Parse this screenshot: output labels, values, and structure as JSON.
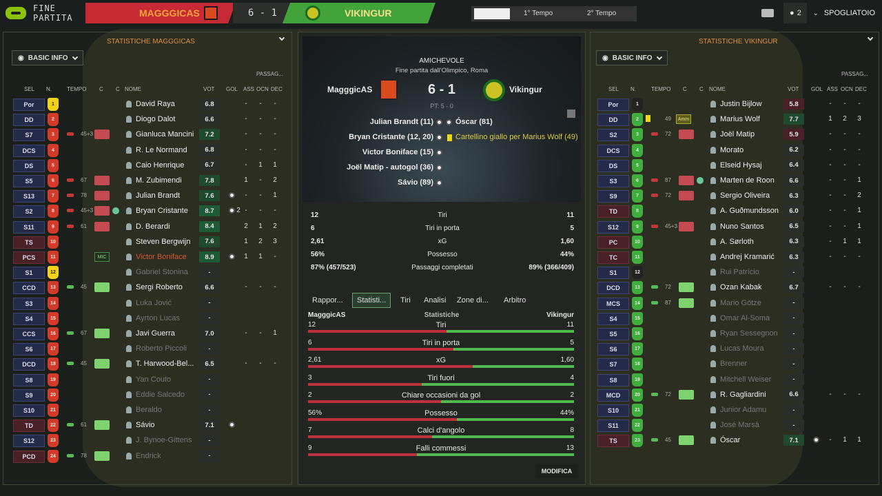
{
  "topbar": {
    "status": "FINE PARTITA",
    "home": "MAGGGICAS",
    "score": "6 - 1",
    "away": "VIKINGUR",
    "first_half": "1° Tempo",
    "second_half": "2° Tempo",
    "manager_count": "2",
    "spogliatoio": "SPOGLIATOIO"
  },
  "left": {
    "header": "STATISTICHE MAGGGICAS",
    "basic": "BASIC INFO",
    "cols": {
      "sel": "SEL",
      "n": "N.",
      "tempo": "TEMPO",
      "c1": "C",
      "c2": "C",
      "nome": "NOME",
      "vot": "VOT",
      "gol": "GOL",
      "ass": "ASS",
      "ocn": "OCN",
      "dec": "DEC",
      "passag": "PASSAG..."
    },
    "players": [
      {
        "sel": "Por",
        "num": "1",
        "name": "David Raya",
        "vot": "6.8",
        "ass": "-",
        "ocn": "-",
        "dec": "-",
        "gk": true,
        "active": true,
        "vc": "#2a2e2b"
      },
      {
        "sel": "DD",
        "num": "2",
        "name": "Diogo Dalot",
        "vot": "6.6",
        "ass": "-",
        "ocn": "-",
        "dec": "-",
        "active": true,
        "vc": "#2a2e2b"
      },
      {
        "sel": "S7",
        "num": "3",
        "name": "Gianluca Mancini",
        "vot": "7.2",
        "tem": "45+3",
        "ass": "-",
        "ocn": "-",
        "dec": "-",
        "sub": "out",
        "vc": "#1f4a2f"
      },
      {
        "sel": "DCS",
        "num": "4",
        "name": "R. Le Normand",
        "vot": "6.8",
        "ass": "-",
        "ocn": "-",
        "dec": "-",
        "active": true,
        "vc": "#2a2e2b"
      },
      {
        "sel": "DS",
        "num": "5",
        "name": "Caio Henrique",
        "vot": "6.7",
        "ass": "-",
        "ocn": "1",
        "dec": "1",
        "active": true,
        "vc": "#2a2e2b"
      },
      {
        "sel": "S5",
        "num": "6",
        "name": "M. Zubimendi",
        "vot": "7.8",
        "tem": "67",
        "ass": "1",
        "ocn": "-",
        "dec": "2",
        "sub": "out",
        "vc": "#1f4a2f"
      },
      {
        "sel": "S13",
        "num": "7",
        "name": "Julian Brandt",
        "vot": "7.6",
        "tem": "78",
        "ass": "-",
        "ocn": "-",
        "dec": "1",
        "sub": "out",
        "goal": true,
        "vc": "#1f4a2f"
      },
      {
        "sel": "S2",
        "num": "8",
        "name": "Bryan Cristante",
        "vot": "8.7",
        "tem": "45+3",
        "gol": "2",
        "ass": "-",
        "ocn": "-",
        "dec": "-",
        "sub": "out",
        "cap": true,
        "goal": true,
        "vc": "#1f5a37"
      },
      {
        "sel": "S11",
        "num": "9",
        "name": "D. Berardi",
        "vot": "8.4",
        "tem": "61",
        "ass": "2",
        "ocn": "1",
        "dec": "2",
        "sub": "out",
        "vc": "#1f5a37"
      },
      {
        "sel": "TS",
        "num": "10",
        "name": "Steven Bergwijn",
        "vot": "7.6",
        "ass": "1",
        "ocn": "2",
        "dec": "3",
        "active": true,
        "red": true,
        "vc": "#1f4a2f"
      },
      {
        "sel": "PCS",
        "num": "11",
        "name": "Victor Boniface",
        "vot": "8.9",
        "ass": "1",
        "ocn": "1",
        "dec": "-",
        "active": true,
        "mic": true,
        "goal": true,
        "hl": true,
        "red": true,
        "vc": "#1f5a37"
      },
      {
        "sel": "S1",
        "num": "12",
        "name": "Gabriel Stonina",
        "vot": "-",
        "ass": "",
        "ocn": "",
        "dec": "",
        "gk": true
      },
      {
        "sel": "CCD",
        "num": "13",
        "name": "Sergi Roberto",
        "vot": "6.6",
        "tem": "45",
        "ass": "-",
        "ocn": "-",
        "dec": "-",
        "sub": "in",
        "active": true,
        "vc": "#2a2e2b"
      },
      {
        "sel": "S3",
        "num": "14",
        "name": "Luka Jović",
        "vot": "-",
        "ass": "",
        "ocn": "",
        "dec": ""
      },
      {
        "sel": "S4",
        "num": "15",
        "name": "Ayrton Lucas",
        "vot": "-",
        "ass": "",
        "ocn": "",
        "dec": ""
      },
      {
        "sel": "CCS",
        "num": "16",
        "name": "Javi Guerra",
        "vot": "7.0",
        "tem": "67",
        "ass": "-",
        "ocn": "-",
        "dec": "1",
        "sub": "in",
        "active": true,
        "vc": "#2a2e2b"
      },
      {
        "sel": "S6",
        "num": "17",
        "name": "Roberto Piccoli",
        "vot": "-",
        "ass": "",
        "ocn": "",
        "dec": ""
      },
      {
        "sel": "DCD",
        "num": "18",
        "name": "T. Harwood-Bel...",
        "vot": "6.5",
        "tem": "45",
        "ass": "-",
        "ocn": "-",
        "dec": "-",
        "sub": "in",
        "active": true,
        "vc": "#2a2e2b"
      },
      {
        "sel": "S8",
        "num": "19",
        "name": "Yan Couto",
        "vot": "-",
        "ass": "",
        "ocn": "",
        "dec": ""
      },
      {
        "sel": "S9",
        "num": "20",
        "name": "Eddie Salcedo",
        "vot": "-",
        "ass": "",
        "ocn": "",
        "dec": ""
      },
      {
        "sel": "S10",
        "num": "21",
        "name": "Beraldo",
        "vot": "-",
        "ass": "",
        "ocn": "",
        "dec": ""
      },
      {
        "sel": "TD",
        "num": "22",
        "name": "Sávio",
        "vot": "7.1",
        "tem": "61",
        "ass": "",
        "ocn": "",
        "dec": "",
        "sub": "in",
        "active": true,
        "goal": true,
        "red": true,
        "vc": "#2a2e2b"
      },
      {
        "sel": "S12",
        "num": "23",
        "name": "J. Bynoe-Gittens",
        "vot": "-",
        "ass": "",
        "ocn": "",
        "dec": ""
      },
      {
        "sel": "PCD",
        "num": "24",
        "name": "Endrick",
        "vot": "-",
        "tem": "78",
        "ass": "",
        "ocn": "",
        "dec": "",
        "sub": "in",
        "active": true,
        "red": true
      }
    ]
  },
  "right": {
    "header": "STATISTICHE VIKINGUR",
    "basic": "BASIC INFO",
    "cols": {
      "sel": "SEL",
      "n": "N.",
      "tempo": "TEMPO",
      "c1": "C",
      "c2": "C",
      "nome": "NOME",
      "vot": "VOT",
      "gol": "GOL",
      "ass": "ASS",
      "ocn": "OCN",
      "dec": "DEC",
      "passag": "PASSAG..."
    },
    "players": [
      {
        "sel": "Por",
        "num": "1",
        "name": "Justin Bijlow",
        "vot": "5.8",
        "ass": "-",
        "ocn": "-",
        "dec": "-",
        "gk": true,
        "active": true,
        "vc": "#4a2027"
      },
      {
        "sel": "DD",
        "num": "2",
        "name": "Marius Wolf",
        "vot": "7.7",
        "tem": "49",
        "ass": "1",
        "ocn": "2",
        "dec": "3",
        "amm": true,
        "active": true,
        "vc": "#1f4a2f"
      },
      {
        "sel": "S2",
        "num": "3",
        "name": "Joël Matip",
        "vot": "5.9",
        "tem": "72",
        "ass": "-",
        "ocn": "-",
        "dec": "-",
        "sub": "out",
        "vc": "#4a2027"
      },
      {
        "sel": "DCS",
        "num": "4",
        "name": "Morato",
        "vot": "6.2",
        "ass": "-",
        "ocn": "-",
        "dec": "-",
        "active": true,
        "vc": "#2a2e2b"
      },
      {
        "sel": "DS",
        "num": "5",
        "name": "Elseid Hysaj",
        "vot": "6.4",
        "ass": "-",
        "ocn": "-",
        "dec": "-",
        "active": true,
        "vc": "#2a2e2b"
      },
      {
        "sel": "S3",
        "num": "6",
        "name": "Marten de Roon",
        "vot": "6.6",
        "tem": "87",
        "ass": "-",
        "ocn": "-",
        "dec": "1",
        "sub": "out",
        "cap": true,
        "vc": "#2a2e2b"
      },
      {
        "sel": "S9",
        "num": "7",
        "name": "Sergio Oliveira",
        "vot": "6.3",
        "tem": "72",
        "ass": "-",
        "ocn": "-",
        "dec": "2",
        "sub": "out",
        "vc": "#2a2e2b"
      },
      {
        "sel": "TD",
        "num": "8",
        "name": "A. Guðmundsson",
        "vot": "6.0",
        "ass": "-",
        "ocn": "-",
        "dec": "1",
        "active": true,
        "red": true,
        "vc": "#2a2e2b"
      },
      {
        "sel": "S12",
        "num": "9",
        "name": "Nuno Santos",
        "vot": "6.5",
        "tem": "45+3",
        "ass": "-",
        "ocn": "-",
        "dec": "1",
        "sub": "out",
        "vc": "#2a2e2b"
      },
      {
        "sel": "PC",
        "num": "10",
        "name": "A. Sørloth",
        "vot": "6.3",
        "ass": "-",
        "ocn": "1",
        "dec": "1",
        "active": true,
        "red": true,
        "vc": "#2a2e2b"
      },
      {
        "sel": "TC",
        "num": "11",
        "name": "Andrej Kramarić",
        "vot": "6.3",
        "ass": "-",
        "ocn": "-",
        "dec": "-",
        "active": true,
        "red": true,
        "vc": "#2a2e2b"
      },
      {
        "sel": "S1",
        "num": "12",
        "name": "Rui Patrício",
        "vot": "-",
        "ass": "",
        "ocn": "",
        "dec": "",
        "gk": true
      },
      {
        "sel": "DCD",
        "num": "13",
        "name": "Ozan Kabak",
        "vot": "6.7",
        "tem": "72",
        "ass": "-",
        "ocn": "-",
        "dec": "-",
        "sub": "in",
        "active": true,
        "vc": "#2a2e2b"
      },
      {
        "sel": "MCS",
        "num": "14",
        "name": "Mario Götze",
        "vot": "-",
        "tem": "87",
        "ass": "",
        "ocn": "",
        "dec": "",
        "sub": "in",
        "active": true
      },
      {
        "sel": "S4",
        "num": "15",
        "name": "Omar Al-Soma",
        "vot": "-",
        "ass": "",
        "ocn": "",
        "dec": ""
      },
      {
        "sel": "S5",
        "num": "16",
        "name": "Ryan Sessegnon",
        "vot": "-",
        "ass": "",
        "ocn": "",
        "dec": ""
      },
      {
        "sel": "S6",
        "num": "17",
        "name": "Lucas Moura",
        "vot": "-",
        "ass": "",
        "ocn": "",
        "dec": ""
      },
      {
        "sel": "S7",
        "num": "18",
        "name": "Brenner",
        "vot": "-",
        "ass": "",
        "ocn": "",
        "dec": ""
      },
      {
        "sel": "S8",
        "num": "19",
        "name": "Mitchell Weiser",
        "vot": "-",
        "ass": "",
        "ocn": "",
        "dec": ""
      },
      {
        "sel": "MCD",
        "num": "20",
        "name": "R. Gagliardini",
        "vot": "6.6",
        "tem": "72",
        "ass": "-",
        "ocn": "-",
        "dec": "-",
        "sub": "in",
        "active": true,
        "vc": "#2a2e2b"
      },
      {
        "sel": "S10",
        "num": "21",
        "name": "Junior Adamu",
        "vot": "-",
        "ass": "",
        "ocn": "",
        "dec": ""
      },
      {
        "sel": "S11",
        "num": "22",
        "name": "José Marsà",
        "vot": "-",
        "ass": "",
        "ocn": "",
        "dec": ""
      },
      {
        "sel": "TS",
        "num": "23",
        "name": "Óscar",
        "vot": "7.1",
        "tem": "45",
        "ass": "-",
        "ocn": "1",
        "dec": "1",
        "sub": "in",
        "active": true,
        "goal": true,
        "red": true,
        "vc": "#1f4a2f"
      }
    ]
  },
  "center": {
    "competition": "AMICHEVOLE",
    "venue": "Fine partita dall'Olimpico, Roma",
    "home": "MagggicAS",
    "away": "Vikingur",
    "score": "6 - 1",
    "ht": "PT: 5 - 0",
    "home_events": [
      "Julian Brandt (11)",
      "Bryan Cristante (12, 20)",
      "Victor Boniface (15)",
      "Joël Matip - autogol (36)",
      "Sávio (89)"
    ],
    "away_events": [
      "Óscar (81)",
      "Cartellino giallo per Marius Wolf (49)"
    ],
    "summary": [
      {
        "l": "12",
        "c": "Tiri",
        "r": "11"
      },
      {
        "l": "6",
        "c": "Tiri in porta",
        "r": "5"
      },
      {
        "l": "2,61",
        "c": "xG",
        "r": "1,60"
      },
      {
        "l": "56%",
        "c": "Possesso",
        "r": "44%"
      },
      {
        "l": "87% (457/523)",
        "c": "Passaggi completati",
        "r": "89% (366/409)"
      }
    ],
    "tabs": [
      "Rappor...",
      "Statisti...",
      "Tiri",
      "Analisi",
      "Zone di...",
      "Arbitro"
    ],
    "stats_header": {
      "l": "MagggicAS",
      "c": "Statistiche",
      "r": "Vikingur"
    },
    "stats": [
      {
        "l": "12",
        "c": "Tiri",
        "r": "11",
        "lv": 12,
        "rv": 11
      },
      {
        "l": "6",
        "c": "Tiri in porta",
        "r": "5",
        "lv": 6,
        "rv": 5
      },
      {
        "l": "2,61",
        "c": "xG",
        "r": "1,60",
        "lv": 2.61,
        "rv": 1.6
      },
      {
        "l": "3",
        "c": "Tiri fuori",
        "r": "4",
        "lv": 3,
        "rv": 4
      },
      {
        "l": "2",
        "c": "Chiare occasioni da gol",
        "r": "2",
        "lv": 2,
        "rv": 2
      },
      {
        "l": "56%",
        "c": "Possesso",
        "r": "44%",
        "lv": 56,
        "rv": 44
      },
      {
        "l": "7",
        "c": "Calci d'angolo",
        "r": "8",
        "lv": 7,
        "rv": 8
      },
      {
        "l": "9",
        "c": "Falli commessi",
        "r": "13",
        "lv": 9,
        "rv": 13
      }
    ],
    "modifica": "MODIFICA"
  },
  "colors": {
    "home": "#c72a35",
    "away": "#41a33a",
    "home_name": "#f5a43c",
    "away_name": "#f3e08a"
  }
}
